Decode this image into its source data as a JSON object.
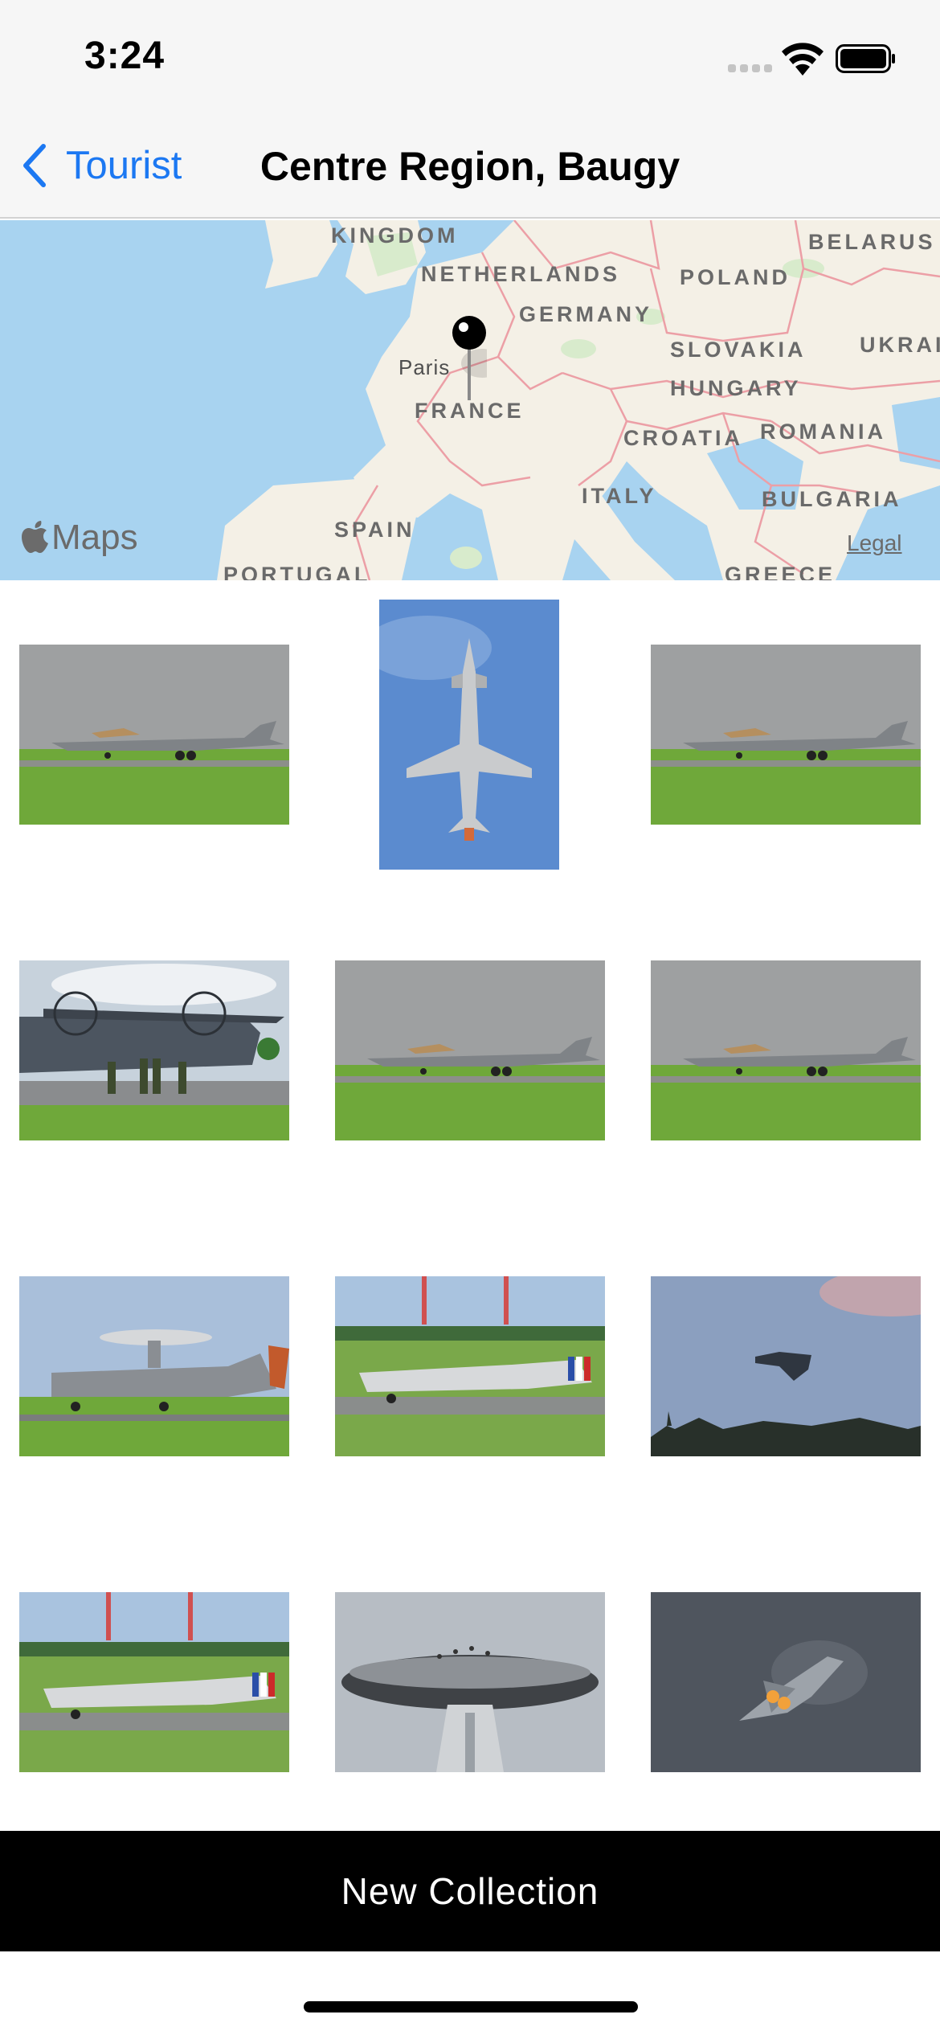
{
  "status_bar": {
    "time": "3:24"
  },
  "nav": {
    "back_label": "Tourist",
    "title": "Centre Region, Baugy"
  },
  "map": {
    "attribution": "Maps",
    "legal": "Legal",
    "labels": {
      "kingdom": "KINGDOM",
      "netherlands": "NETHERLANDS",
      "germany": "GERMANY",
      "poland": "POLAND",
      "belarus": "BELARUS",
      "slovakia": "SLOVAKIA",
      "ukraine": "UKRAI",
      "hungary": "HUNGARY",
      "france": "FRANCE",
      "croatia": "CROATIA",
      "romania": "ROMANIA",
      "italy": "ITALY",
      "bulgaria": "BULGARIA",
      "spain": "SPAIN",
      "portugal": "PORTUGAL",
      "greece": "GREECE",
      "paris": "Paris"
    }
  },
  "photos": [
    {
      "subject": "rafale-taxi"
    },
    {
      "subject": "eurofighter-overhead"
    },
    {
      "subject": "rafale-taxi"
    },
    {
      "subject": "a400m-crew"
    },
    {
      "subject": "rafale-taxi"
    },
    {
      "subject": "rafale-taxi"
    },
    {
      "subject": "hawkeye-landing"
    },
    {
      "subject": "vampire-takeoff"
    },
    {
      "subject": "jet-banking"
    },
    {
      "subject": "vampire-takeoff"
    },
    {
      "subject": "control-tower"
    },
    {
      "subject": "rafale-afterburner"
    }
  ],
  "footer": {
    "button_label": "New Collection"
  },
  "colors": {
    "accent": "#1c78f2",
    "button_bg": "#000000",
    "nav_bg": "#f6f6f6",
    "grass": "#6fa83a",
    "sky_grey": "#9a9c9e"
  }
}
